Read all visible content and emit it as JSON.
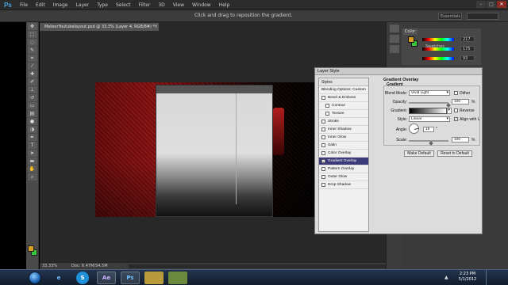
{
  "app": {
    "logo": "Ps",
    "menu": [
      "File",
      "Edit",
      "Image",
      "Layer",
      "Type",
      "Select",
      "Filter",
      "3D",
      "View",
      "Window",
      "Help"
    ],
    "window_controls": [
      "–",
      "□",
      "✕"
    ]
  },
  "options_bar": {
    "hint": "Click and drag to reposition the gradient.",
    "workspace": "Essentials"
  },
  "document": {
    "tab_title": "MeteorYoutubelayout.psd @ 33.3% (Layer 4, RGB/8#) *",
    "tab_close": "×",
    "zoom": "33.33%",
    "doc_size": "Doc: 6.47M/54.5M"
  },
  "colors": {
    "foreground": "#d9a020",
    "background": "#39c93c",
    "dialog_selection": "#3b3b7a"
  },
  "color_panel": {
    "tab": "Color",
    "swatches_tab": "Swatches",
    "values": [
      "217",
      "175",
      "93"
    ]
  },
  "layer_style": {
    "title": "Layer Style",
    "styles_header": "Styles",
    "blending_options": "Blending Options: Custom",
    "items": [
      {
        "label": "Bevel & Emboss",
        "checked": false,
        "indent": false,
        "active": false
      },
      {
        "label": "Contour",
        "checked": false,
        "indent": true,
        "active": false
      },
      {
        "label": "Texture",
        "checked": false,
        "indent": true,
        "active": false
      },
      {
        "label": "Stroke",
        "checked": false,
        "indent": false,
        "active": false
      },
      {
        "label": "Inner Shadow",
        "checked": false,
        "indent": false,
        "active": false
      },
      {
        "label": "Inner Glow",
        "checked": false,
        "indent": false,
        "active": false
      },
      {
        "label": "Satin",
        "checked": false,
        "indent": false,
        "active": false
      },
      {
        "label": "Color Overlay",
        "checked": false,
        "indent": false,
        "active": false
      },
      {
        "label": "Gradient Overlay",
        "checked": true,
        "indent": false,
        "active": true
      },
      {
        "label": "Pattern Overlay",
        "checked": false,
        "indent": false,
        "active": false
      },
      {
        "label": "Outer Glow",
        "checked": false,
        "indent": false,
        "active": false
      },
      {
        "label": "Drop Shadow",
        "checked": false,
        "indent": false,
        "active": false
      }
    ],
    "gradient_overlay": {
      "title": "Gradient Overlay",
      "section": "Gradient",
      "blend_mode_label": "Blend Mode:",
      "blend_mode": "Vivid Light",
      "dither_label": "Dither",
      "opacity_label": "Opacity:",
      "opacity": "100",
      "gradient_label": "Gradient:",
      "reverse_label": "Reverse",
      "style_label": "Style:",
      "style": "Linear",
      "align_label": "Align with Layer",
      "angle_label": "Angle:",
      "angle": "15",
      "angle_unit": "°",
      "scale_label": "Scale:",
      "scale": "100",
      "percent": "%",
      "make_default": "Make Default",
      "reset_default": "Reset to Default"
    }
  },
  "taskbar": {
    "apps": [
      "e",
      "S",
      "Ae",
      "Ps",
      "",
      ""
    ],
    "time": "2:23 PM",
    "date": "5/1/2012",
    "tray_arrow": "▲"
  }
}
